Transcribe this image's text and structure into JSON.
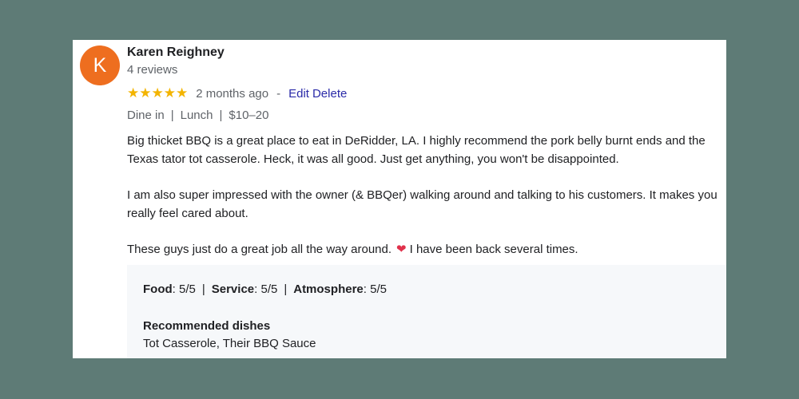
{
  "review": {
    "avatar_letter": "K",
    "avatar_color": "#ee6e1f",
    "author_name": "Karen Reighney",
    "review_count": "4 reviews",
    "stars_glyph": "★★★★★",
    "rating": 5,
    "rating_max": 5,
    "star_color": "#f3b400",
    "time_ago": "2 months ago",
    "separator": "-",
    "edit_label": "Edit",
    "delete_label": "Delete",
    "meta": {
      "service_type": "Dine in",
      "meal_type": "Lunch",
      "price_range": "$10–20"
    },
    "paragraphs": {
      "p1": "Big thicket BBQ  is a great place to eat in DeRidder, LA.  I highly recommend the pork belly burnt ends and the Texas tator tot casserole.  Heck, it was all good. Just get anything,  you won't be disappointed.",
      "p2": "I am also super impressed with the owner (& BBQer) walking around and talking to his customers.  It makes you really feel cared about.",
      "p3_before": "These guys just do a great  job  all the way around.",
      "p3_after": "I have been  back several times."
    },
    "heart_icon": "heart-icon",
    "heart_glyph": "❤",
    "scores": {
      "food_label": "Food",
      "food_value": ": 5/5",
      "service_label": "Service",
      "service_value": ": 5/5",
      "atmosphere_label": "Atmosphere",
      "atmosphere_value": ": 5/5"
    },
    "recommended": {
      "title": "Recommended dishes",
      "dishes": "Tot Casserole, Their BBQ Sauce"
    }
  }
}
